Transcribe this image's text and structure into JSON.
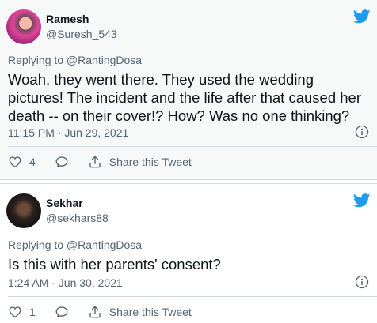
{
  "tweets": [
    {
      "display_name": "Ramesh",
      "handle": "@Suresh_543",
      "replying_to": "Replying to @RantingDosa",
      "text": "Woah, they went there. They used the wedding pictures! The incident and the life after that caused her death -- on their cover!? How? Was no one thinking?",
      "timestamp": "11:15 PM · Jun 29, 2021",
      "like_count": "4",
      "share_label": "Share this Tweet"
    },
    {
      "display_name": "Sekhar",
      "handle": "@sekhars88",
      "replying_to": "Replying to @RantingDosa",
      "text": "Is this with her parents' consent?",
      "timestamp": "1:24 AM · Jun 30, 2021",
      "like_count": "1",
      "share_label": "Share this Tweet"
    }
  ],
  "colors": {
    "twitter_blue": "#1d9bf0",
    "secondary_text": "#536471",
    "primary_text": "#0f1419"
  },
  "icons": [
    "twitter-bird-icon",
    "info-icon",
    "heart-icon",
    "comment-icon",
    "share-icon"
  ]
}
